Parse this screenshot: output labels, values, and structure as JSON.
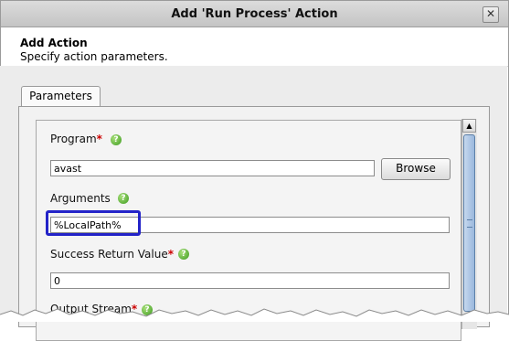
{
  "window": {
    "title": "Add 'Run Process' Action"
  },
  "header": {
    "title": "Add Action",
    "subtitle": "Specify action parameters."
  },
  "tabs": [
    {
      "label": "Parameters"
    }
  ],
  "form": {
    "program": {
      "label": "Program",
      "required": "*",
      "value": "avast",
      "browse_label": "Browse"
    },
    "arguments": {
      "label": "Arguments",
      "value": "%LocalPath%"
    },
    "success_return": {
      "label": "Success Return Value",
      "required": "*",
      "value": "0"
    },
    "output_stream": {
      "label": "Output Stream",
      "required": "*"
    }
  },
  "icons": {
    "help": "help-icon",
    "close": "close-icon",
    "scroll_up": "arrow-up-icon"
  },
  "colors": {
    "highlight": "#2323c8",
    "required": "#cc0000",
    "help": "#3c9a1e"
  }
}
